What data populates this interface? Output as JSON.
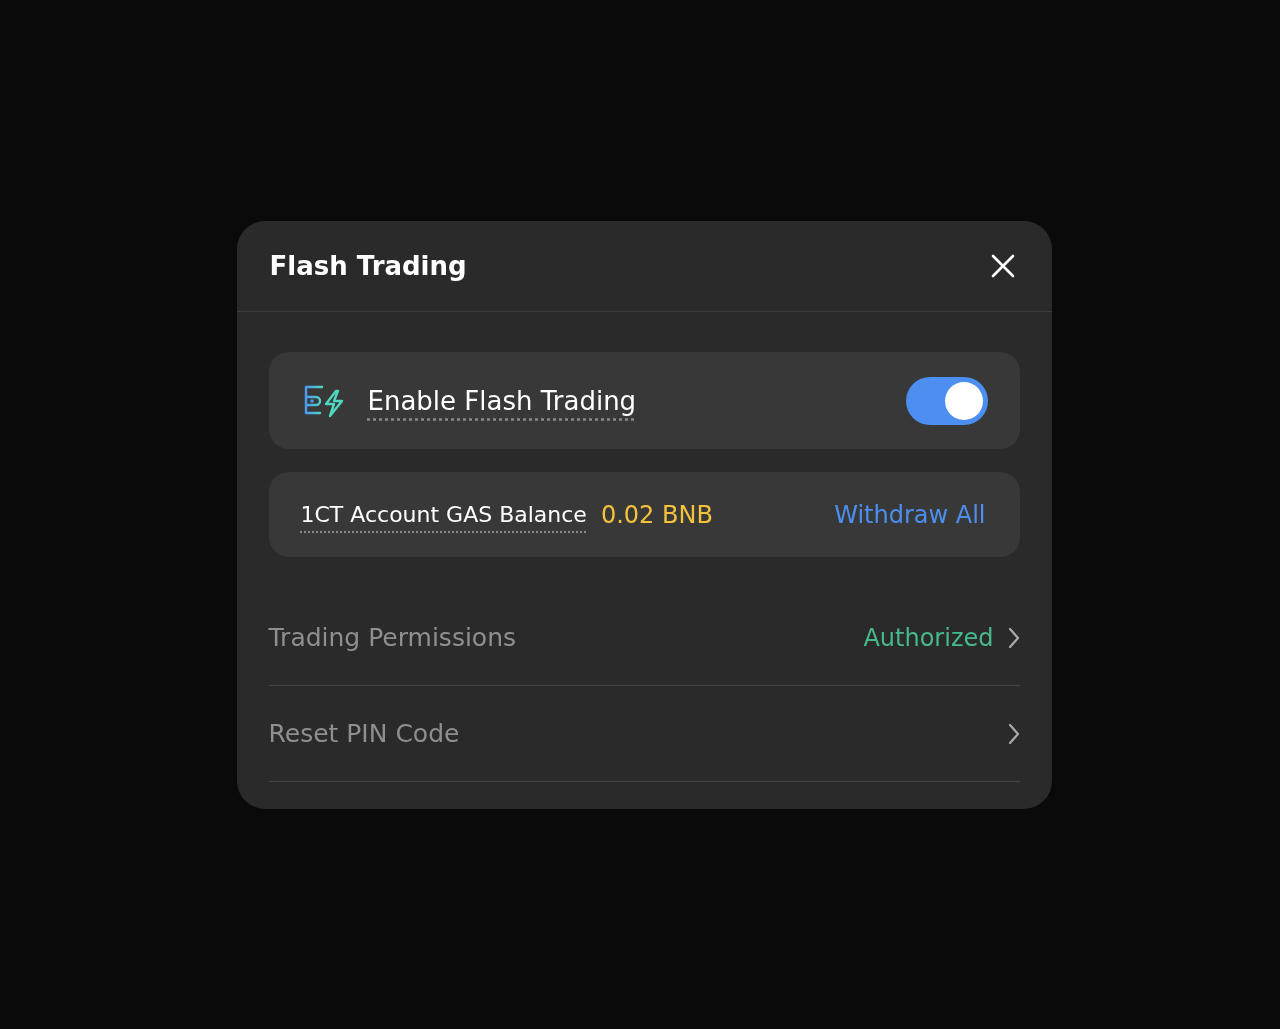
{
  "dialog": {
    "title": "Flash Trading"
  },
  "toggle_row": {
    "label": "Enable Flash Trading",
    "on": true
  },
  "balance_row": {
    "label": "1CT Account GAS Balance",
    "value": "0.02 BNB",
    "action": "Withdraw All"
  },
  "settings": [
    {
      "label": "Trading Permissions",
      "status": "Authorized"
    },
    {
      "label": "Reset PIN Code"
    }
  ]
}
